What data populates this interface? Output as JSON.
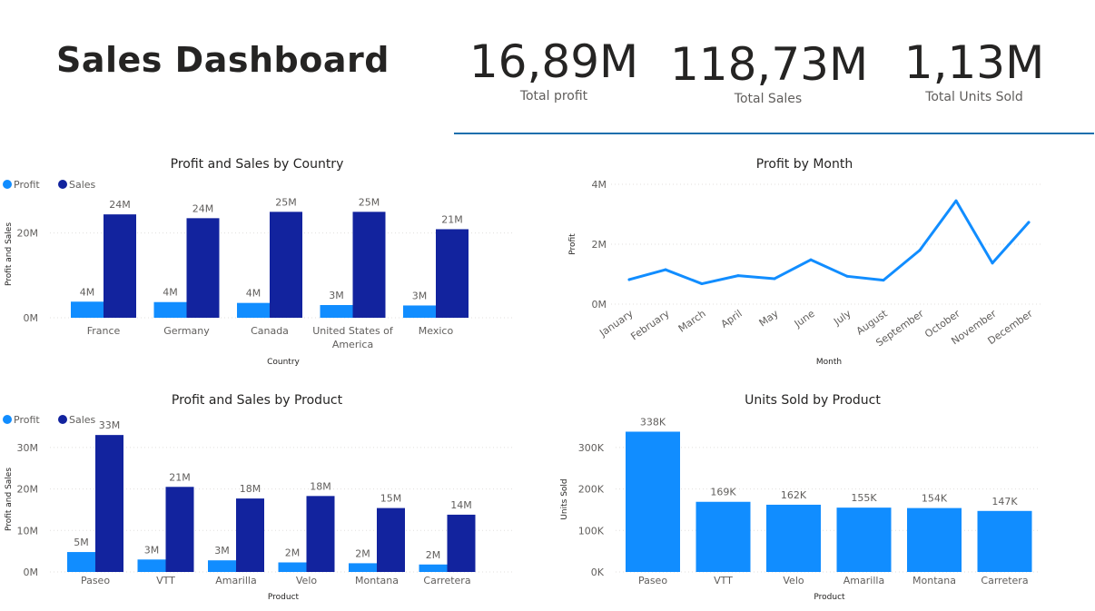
{
  "dashboard": {
    "title": "Sales Dashboard"
  },
  "kpis": [
    {
      "value": "16,89M",
      "label": "Total profit"
    },
    {
      "value": "118,73M",
      "label": "Total Sales"
    },
    {
      "value": "1,13M",
      "label": "Total Units Sold"
    }
  ],
  "colors": {
    "profit": "#118dff",
    "sales": "#12239e",
    "line": "#118dff",
    "units": "#118dff",
    "divider": "#1f6fad"
  },
  "chart_data": [
    {
      "id": "country",
      "type": "bar",
      "title": "Profit and Sales by Country",
      "xlabel": "Country",
      "ylabel": "Profit and Sales",
      "legend_position": "top-left",
      "categories": [
        [
          "France"
        ],
        [
          "Germany"
        ],
        [
          "Canada"
        ],
        [
          "United States of",
          "America"
        ],
        [
          "Mexico"
        ]
      ],
      "series": [
        {
          "name": "Profit",
          "values": [
            3.8,
            3.7,
            3.5,
            3.0,
            2.9
          ],
          "labels": [
            "4M",
            "4M",
            "4M",
            "3M",
            "3M"
          ]
        },
        {
          "name": "Sales",
          "values": [
            24.4,
            23.5,
            25.0,
            25.0,
            20.9
          ],
          "labels": [
            "24M",
            "24M",
            "25M",
            "25M",
            "21M"
          ]
        }
      ],
      "ylim": [
        0,
        30
      ],
      "yticks": [
        0,
        20
      ],
      "ytick_labels": [
        "0M",
        "20M"
      ],
      "grid": true
    },
    {
      "id": "month",
      "type": "line",
      "title": "Profit by Month",
      "xlabel": "Month",
      "ylabel": "Profit",
      "categories": [
        "January",
        "February",
        "March",
        "April",
        "May",
        "June",
        "July",
        "August",
        "September",
        "October",
        "November",
        "December"
      ],
      "values": [
        0.82,
        1.15,
        0.68,
        0.95,
        0.85,
        1.48,
        0.93,
        0.8,
        1.8,
        3.45,
        1.37,
        2.73
      ],
      "ylim": [
        0,
        4
      ],
      "yticks": [
        0,
        2,
        4
      ],
      "ytick_labels": [
        "0M",
        "2M",
        "4M"
      ],
      "grid": true
    },
    {
      "id": "product",
      "type": "bar",
      "title": "Profit and Sales by Product",
      "xlabel": "Product",
      "ylabel": "Profit and Sales",
      "legend_position": "top-left",
      "categories": [
        [
          "Paseo"
        ],
        [
          "VTT"
        ],
        [
          "Amarilla"
        ],
        [
          "Velo"
        ],
        [
          "Montana"
        ],
        [
          "Carretera"
        ]
      ],
      "series": [
        {
          "name": "Profit",
          "values": [
            4.8,
            3.0,
            2.8,
            2.3,
            2.1,
            1.8
          ],
          "labels": [
            "5M",
            "3M",
            "3M",
            "2M",
            "2M",
            "2M"
          ]
        },
        {
          "name": "Sales",
          "values": [
            33.0,
            20.5,
            17.7,
            18.3,
            15.4,
            13.8
          ],
          "labels": [
            "33M",
            "21M",
            "18M",
            "18M",
            "15M",
            "14M"
          ]
        }
      ],
      "ylim": [
        0,
        35
      ],
      "yticks": [
        0,
        10,
        20,
        30
      ],
      "ytick_labels": [
        "0M",
        "10M",
        "20M",
        "30M"
      ],
      "grid": true
    },
    {
      "id": "units",
      "type": "bar",
      "title": "Units Sold by Product",
      "xlabel": "Product",
      "ylabel": "Units Sold",
      "categories": [
        [
          "Paseo"
        ],
        [
          "VTT"
        ],
        [
          "Velo"
        ],
        [
          "Amarilla"
        ],
        [
          "Montana"
        ],
        [
          "Carretera"
        ]
      ],
      "series": [
        {
          "name": "Units Sold",
          "values": [
            338,
            169,
            162,
            155,
            154,
            147
          ],
          "labels": [
            "338K",
            "169K",
            "162K",
            "155K",
            "154K",
            "147K"
          ]
        }
      ],
      "ylim": [
        0,
        350
      ],
      "yticks": [
        0,
        100,
        200,
        300
      ],
      "ytick_labels": [
        "0K",
        "100K",
        "200K",
        "300K"
      ],
      "grid": true
    }
  ]
}
